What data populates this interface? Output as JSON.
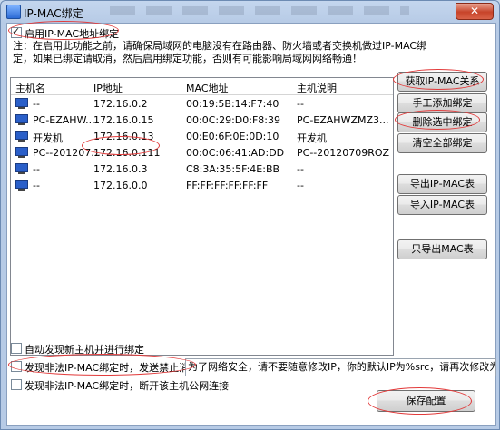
{
  "window": {
    "title": "IP-MAC绑定",
    "close_label": "✕"
  },
  "options": {
    "enable_binding": {
      "label": "启用IP-MAC地址绑定",
      "checked": true
    },
    "auto_discover": {
      "label": "自动发现新主机并进行绑定",
      "checked": false
    },
    "send_ban_message": {
      "label": "发现非法IP-MAC绑定时，发送禁止消息",
      "checked": false
    },
    "disconnect_public": {
      "label": "发现非法IP-MAC绑定时，断开该主机公网连接",
      "checked": false
    }
  },
  "note": {
    "line1": "注：在启用此功能之前，请确保局域网的电脑没有在路由器、防火墙或者交换机做过IP-MAC绑",
    "line2": "定，如果已绑定请取消，然后启用绑定功能，否则有可能影响局域网网络畅通！"
  },
  "table": {
    "headers": [
      "主机名",
      "IP地址",
      "MAC地址",
      "主机说明"
    ],
    "rows": [
      {
        "host": "--",
        "ip": "172.16.0.2",
        "mac": "00:19:5B:14:F7:40",
        "desc": "--"
      },
      {
        "host": "PC-EZAHW...",
        "ip": "172.16.0.15",
        "mac": "00:0C:29:D0:F8:39",
        "desc": "PC-EZAHWZMZ3..."
      },
      {
        "host": "开发机",
        "ip": "172.16.0.13",
        "mac": "00:E0:6F:0E:0D:10",
        "desc": "开发机"
      },
      {
        "host": "PC--201207...",
        "ip": "172.16.0.111",
        "mac": "00:0C:06:41:AD:DD",
        "desc": "PC--20120709ROZ"
      },
      {
        "host": "--",
        "ip": "172.16.0.3",
        "mac": "C8:3A:35:5F:4E:BB",
        "desc": "--"
      },
      {
        "host": "--",
        "ip": "172.16.0.0",
        "mac": "FF:FF:FF:FF:FF:FF",
        "desc": "--"
      }
    ]
  },
  "buttons": {
    "get_ipmac": "获取IP-MAC关系",
    "manual_add": "手工添加绑定",
    "delete_selected": "删除选中绑定",
    "clear_all": "清空全部绑定",
    "export_ipmac": "导出IP-MAC表",
    "import_ipmac": "导入IP-MAC表",
    "export_mac_only": "只导出MAC表",
    "save": "保存配置"
  },
  "ban_message_text": "为了网络安全，请不要随意修改IP，你的默认IP为%src，请再次修改为默",
  "colors": {
    "annotation_ring": "#e23a3a",
    "titlebar": "#c4d6ee",
    "close_button": "#c7442a"
  }
}
